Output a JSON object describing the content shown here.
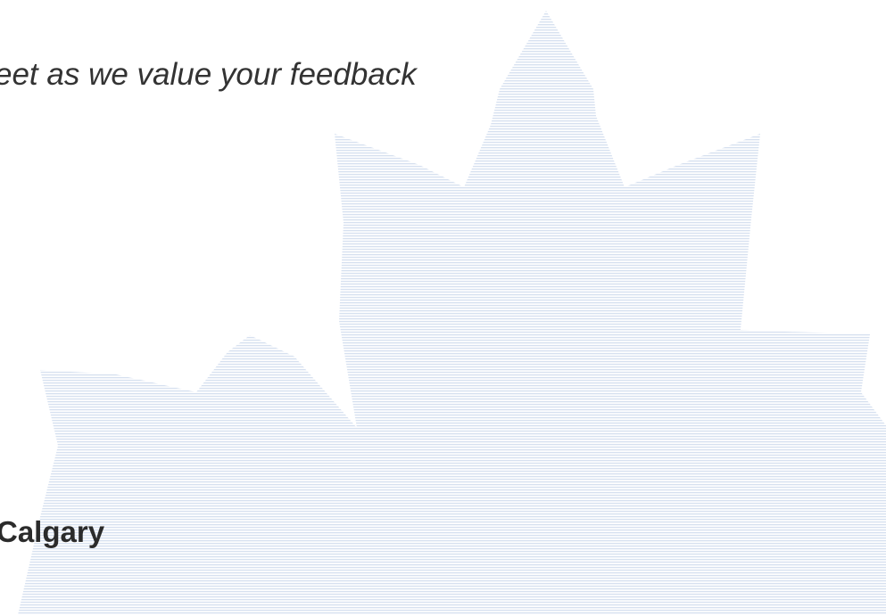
{
  "document": {
    "feedback_text": "eet as we value your feedback",
    "city_text": "Calgary"
  },
  "watermark": {
    "icon": "maple-leaf-icon",
    "color": "#c9d6ea"
  }
}
